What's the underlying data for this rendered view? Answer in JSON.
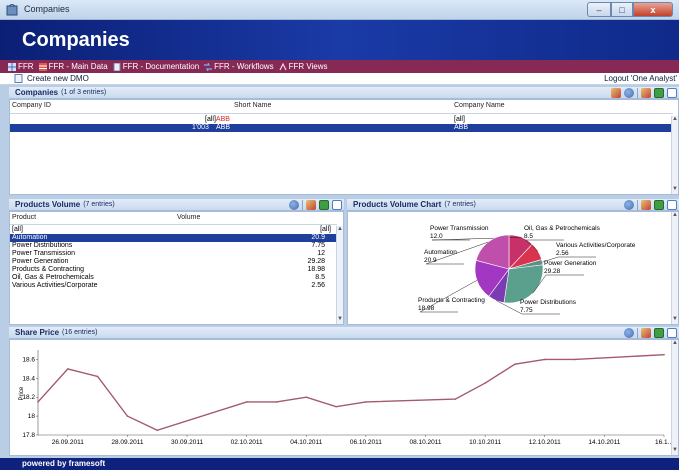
{
  "window": {
    "title": "Companies",
    "controls": [
      "–",
      "□",
      "x"
    ]
  },
  "banner": {
    "title": "Companies"
  },
  "menu": [
    {
      "label": "FFR",
      "icon": "grid-icon"
    },
    {
      "label": "FFR - Main Data",
      "icon": "table-icon"
    },
    {
      "label": "FFR - Documentation",
      "icon": "document-icon"
    },
    {
      "label": "FFR - Workflows",
      "icon": "workflow-icon"
    },
    {
      "label": "FFR Views",
      "icon": "views-icon"
    }
  ],
  "actions": {
    "create": "Create new DMO",
    "logout": "Logout 'One Analyst'"
  },
  "companies": {
    "title": "Companies",
    "count": "(1 of 3 entries)",
    "columns": [
      "Company ID",
      "Short Name",
      "Company Name"
    ],
    "filter": {
      "short_all": "[all]",
      "short_highlight": "ABB",
      "name_all": "[all]"
    },
    "rows": [
      {
        "id": "1'003",
        "short": "ABB",
        "name": "ABB"
      }
    ]
  },
  "products": {
    "title": "Products Volume",
    "count": "(7 entries)",
    "columns": [
      "Product",
      "Volume"
    ],
    "filter": {
      "product": "[all]",
      "volume": "[all]"
    },
    "rows": [
      {
        "product": "Automation",
        "volume": "20.9"
      },
      {
        "product": "Power Distributions",
        "volume": "7.75"
      },
      {
        "product": "Power Transmission",
        "volume": "12"
      },
      {
        "product": "Power Generation",
        "volume": "29.28"
      },
      {
        "product": "Products & Contracting",
        "volume": "18.98"
      },
      {
        "product": "Oil, Gas & Petrochemicals",
        "volume": "8.5"
      },
      {
        "product": "Various Activities/Corporate",
        "volume": "2.56"
      }
    ]
  },
  "pie": {
    "title": "Products Volume Chart",
    "count": "(7 entries)",
    "chart_data": {
      "type": "pie",
      "slices": [
        {
          "label": "Power Transmission",
          "value": 12.0,
          "display": "12.0",
          "color": "#c8306a"
        },
        {
          "label": "Oil, Gas & Petrochemicals",
          "value": 8.5,
          "display": "8.5",
          "color": "#d9334f"
        },
        {
          "label": "Various Activities/Corporate",
          "value": 2.56,
          "display": "2.56",
          "color": "#5c8e8a"
        },
        {
          "label": "Power Generation",
          "value": 29.28,
          "display": "29.28",
          "color": "#5aa08c"
        },
        {
          "label": "Power Distributions",
          "value": 7.75,
          "display": "7.75",
          "color": "#7a3bb3"
        },
        {
          "label": "Products & Contracting",
          "value": 18.98,
          "display": "18.98",
          "color": "#a238c2"
        },
        {
          "label": "Automation",
          "value": 20.9,
          "display": "20.9",
          "color": "#c04eab"
        }
      ]
    }
  },
  "share": {
    "title": "Share Price",
    "count": "(16 entries)",
    "chart_data": {
      "type": "line",
      "ylabel": "Price",
      "ylim": [
        17.8,
        18.7
      ],
      "yticks": [
        "17.8",
        "18",
        "18.2",
        "18.4",
        "18.6"
      ],
      "xticks": [
        "26.09.2011",
        "28.09.2011",
        "30.09.2011",
        "02.10.2011",
        "04.10.2011",
        "06.10.2011",
        "08.10.2011",
        "10.10.2011",
        "12.10.2011",
        "14.10.2011",
        "16.1..."
      ],
      "series": [
        {
          "color": "#a45a6a",
          "points": [
            {
              "x": "25.09.2011",
              "y": 18.15
            },
            {
              "x": "26.09.2011",
              "y": 18.5
            },
            {
              "x": "27.09.2011",
              "y": 18.42
            },
            {
              "x": "28.09.2011",
              "y": 18.0
            },
            {
              "x": "29.09.2011",
              "y": 17.85
            },
            {
              "x": "02.10.2011",
              "y": 18.15
            },
            {
              "x": "03.10.2011",
              "y": 18.15
            },
            {
              "x": "04.10.2011",
              "y": 18.2
            },
            {
              "x": "05.10.2011",
              "y": 18.1
            },
            {
              "x": "06.10.2011",
              "y": 18.15
            },
            {
              "x": "09.10.2011",
              "y": 18.18
            },
            {
              "x": "10.10.2011",
              "y": 18.35
            },
            {
              "x": "11.10.2011",
              "y": 18.55
            },
            {
              "x": "12.10.2011",
              "y": 18.6
            },
            {
              "x": "13.10.2011",
              "y": 18.6
            },
            {
              "x": "16.10.2011",
              "y": 18.65
            }
          ]
        }
      ]
    }
  },
  "footer": {
    "text": "powered by framesoft"
  }
}
